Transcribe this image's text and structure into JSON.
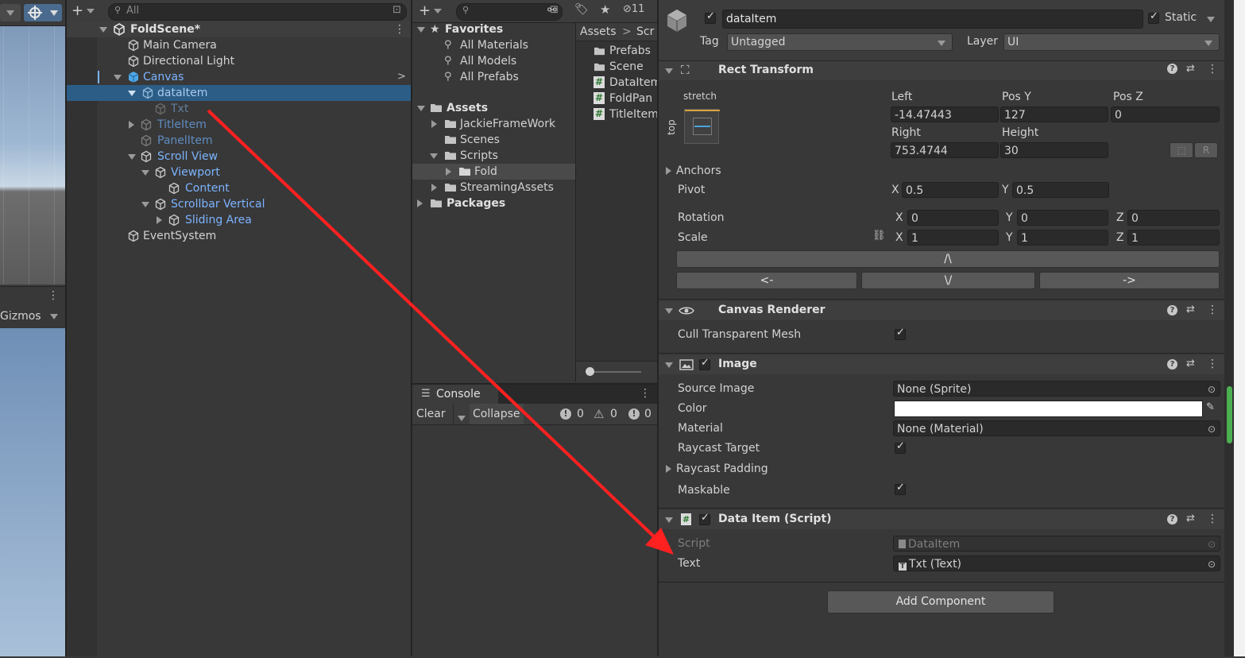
{
  "scene_view": {
    "gizmos_label": "Gizmos"
  },
  "hierarchy": {
    "search_placeholder": "All",
    "scene_name": "FoldScene*",
    "items": [
      {
        "label": "Main Camera"
      },
      {
        "label": "Directional Light"
      },
      {
        "label": "Canvas"
      },
      {
        "label": "dataItem"
      },
      {
        "label": "Txt"
      },
      {
        "label": "TitleItem"
      },
      {
        "label": "PanelItem"
      },
      {
        "label": "Scroll View"
      },
      {
        "label": "Viewport"
      },
      {
        "label": "Content"
      },
      {
        "label": "Scrollbar Vertical"
      },
      {
        "label": "Sliding Area"
      },
      {
        "label": "EventSystem"
      }
    ]
  },
  "project": {
    "hidden_count": "11",
    "favorites": {
      "label": "Favorites",
      "items": [
        "All Materials",
        "All Models",
        "All Prefabs"
      ]
    },
    "assets": {
      "label": "Assets",
      "items": [
        "JackieFrameWork",
        "Scenes",
        "Scripts",
        "Fold",
        "StreamingAssets"
      ]
    },
    "packages_label": "Packages",
    "breadcrumb": [
      "Assets",
      "Scr"
    ],
    "files": [
      "Prefabs",
      "Scene",
      "DataItem",
      "FoldPan",
      "TitleItem"
    ]
  },
  "console": {
    "tab_label": "Console",
    "clear_label": "Clear",
    "collapse_label": "Collapse",
    "counts": {
      "logs": "0",
      "warnings": "0",
      "errors": "0"
    }
  },
  "inspector": {
    "object_name": "dataItem",
    "static_label": "Static",
    "tag_label": "Tag",
    "tag_value": "Untagged",
    "layer_label": "Layer",
    "layer_value": "UI",
    "rect_transform": {
      "title": "Rect Transform",
      "anchor_h": "stretch",
      "anchor_v": "top",
      "left_label": "Left",
      "left_value": "-14.47443",
      "posy_label": "Pos Y",
      "posy_value": "127",
      "posz_label": "Pos Z",
      "posz_value": "0",
      "right_label": "Right",
      "right_value": "753.4744",
      "height_label": "Height",
      "height_value": "30",
      "anchors_label": "Anchors",
      "pivot_label": "Pivot",
      "pivot_x": "0.5",
      "pivot_y": "0.5",
      "rotation_label": "Rotation",
      "rot_x": "0",
      "rot_y": "0",
      "rot_z": "0",
      "scale_label": "Scale",
      "scale_x": "1",
      "scale_y": "1",
      "scale_z": "1",
      "x": "X",
      "y": "Y",
      "z": "Z",
      "btn_up": "/\\",
      "btn_left": "<-",
      "btn_down": "\\/",
      "btn_right": "->"
    },
    "canvas_renderer": {
      "title": "Canvas Renderer",
      "cull_label": "Cull Transparent Mesh"
    },
    "image": {
      "title": "Image",
      "source_label": "Source Image",
      "source_value": "None (Sprite)",
      "color_label": "Color",
      "color_value": "#ffffff",
      "material_label": "Material",
      "material_value": "None (Material)",
      "raycast_label": "Raycast Target",
      "raycast_padding_label": "Raycast Padding",
      "maskable_label": "Maskable"
    },
    "data_item": {
      "title": "Data Item (Script)",
      "script_label": "Script",
      "script_value": "DataItem",
      "text_label": "Text",
      "text_value": "Txt (Text)"
    },
    "add_component": "Add Component"
  },
  "colors": {
    "selection": "#2c5d87",
    "link_blue": "#7cb3ff",
    "dim_blue": "#5f8cc0",
    "annotation": "#ff2020"
  }
}
